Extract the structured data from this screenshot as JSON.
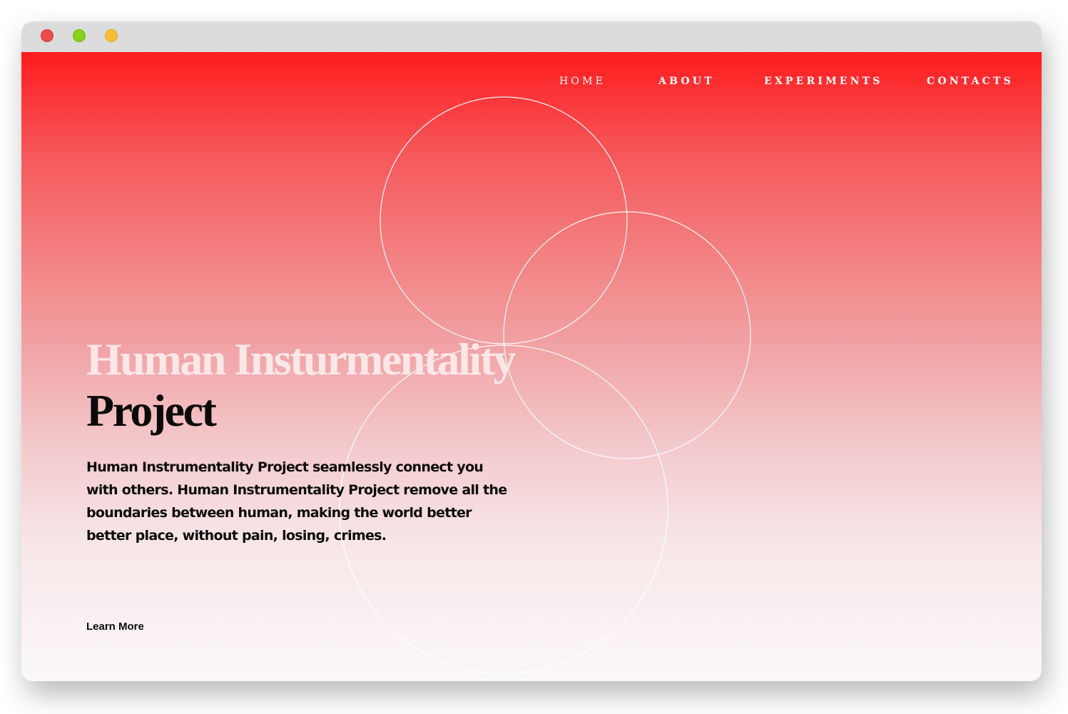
{
  "nav": {
    "items": [
      {
        "label": "HOME"
      },
      {
        "label": "ABOUT"
      },
      {
        "label": "EXPERIMENTS"
      },
      {
        "label": "CONTACTS"
      }
    ]
  },
  "hero": {
    "title_line1": "Human Insturmentality",
    "title_line2": "Project",
    "description": "Human Instrumentality Project seamlessly connect you with others. Human Instrumentality Project remove all the boundaries between human, making the world better better place, without pain, losing, crimes.",
    "cta_label": "Learn More"
  },
  "colors": {
    "gradient_top": "#ff1b1d",
    "gradient_bottom": "#fbf8f8",
    "title_light": "#fce7e8",
    "title_dark": "#0a0a0a",
    "window_close": "#ee4b4b",
    "window_zoom": "#86d11a",
    "window_minimize": "#f8bd32"
  }
}
